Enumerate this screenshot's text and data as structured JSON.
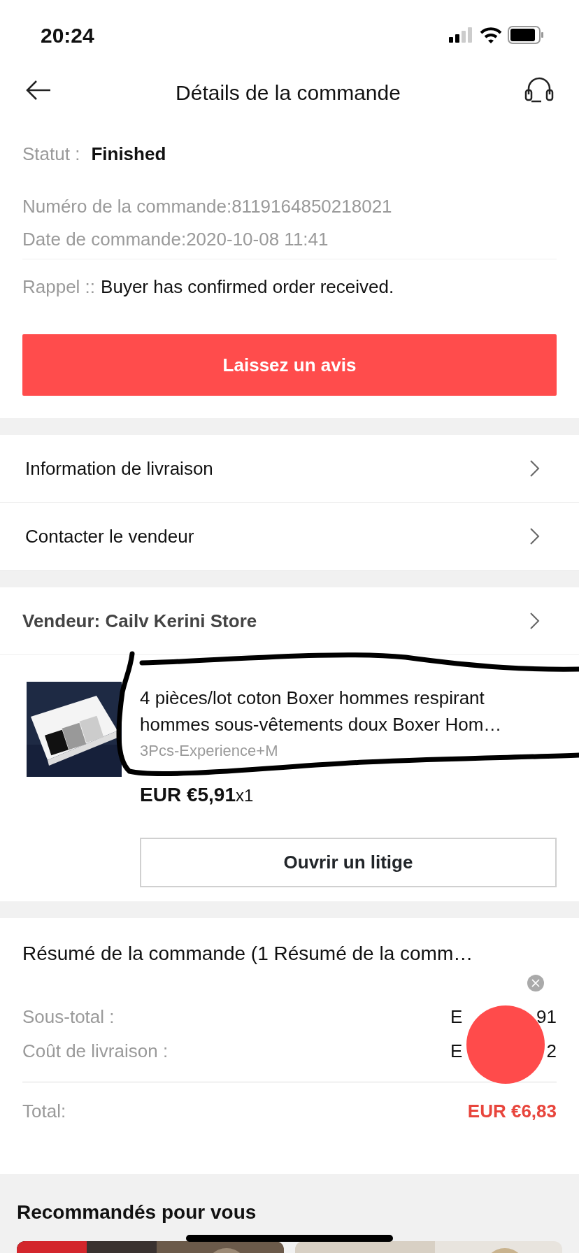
{
  "status_bar": {
    "time": "20:24"
  },
  "header": {
    "title": "Détails de la commande"
  },
  "order": {
    "status_label": "Statut :",
    "status_value": "Finished",
    "number": "Numéro de la commande:8119164850218021",
    "date": "Date de commande:2020-10-08 11:41",
    "reminder_label": "Rappel ::",
    "reminder_text": "Buyer has confirmed order received."
  },
  "review_button": "Laissez un avis",
  "links": [
    {
      "label": "Information de livraison"
    },
    {
      "label": "Contacter le vendeur"
    }
  ],
  "seller": {
    "label": "Vendeur: Cailv Kerini Store"
  },
  "product": {
    "title": "4 pièces/lot coton Boxer hommes respirant hommes sous-vêtements doux Boxer Hom…",
    "variant": "3Pcs-Experience+M",
    "price": "EUR €5,91",
    "quantity": "x1",
    "dispute_button": "Ouvrir un litige"
  },
  "summary": {
    "title": "Résumé de la commande (1 Résumé de la comm…",
    "rows": [
      {
        "label": "Sous-total :",
        "value_parts": [
          "E",
          "91"
        ]
      },
      {
        "label": "Coût de livraison :",
        "value_parts": [
          "E",
          "2"
        ]
      }
    ],
    "total_label": "Total:",
    "total_value": "EUR €6,83"
  },
  "recommended": {
    "title": "Recommandés pour vous"
  }
}
